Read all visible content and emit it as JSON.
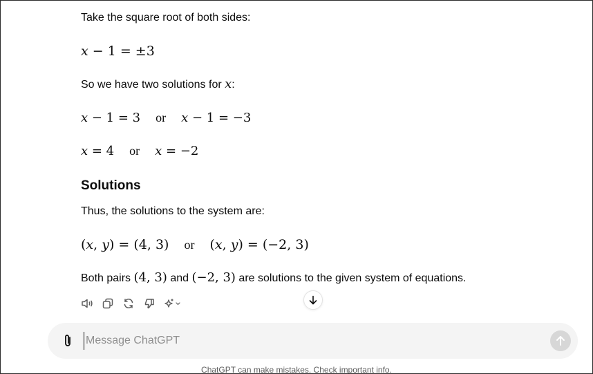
{
  "message": {
    "step_text": "Take the square root of both sides:",
    "eq1": {
      "var": "x",
      "rest": " − 1 = ±3"
    },
    "two_solutions": {
      "before": "So we have two solutions for ",
      "var": "x",
      "after": ":"
    },
    "eq2": {
      "left_var": "x",
      "left_rest": " − 1 = 3",
      "or": "or",
      "right_var": "x",
      "right_rest": " − 1 = −3"
    },
    "eq3": {
      "left_var": "x",
      "left_rest": " = 4",
      "or": "or",
      "right_var": "x",
      "right_rest": " = −2"
    },
    "solutions_heading": "Solutions",
    "thus_text": "Thus, the solutions to the system are:",
    "eq4": {
      "left_open": "(",
      "left_x": "x",
      "left_comma": ", ",
      "left_y": "y",
      "left_close": ") = (4, 3)",
      "or": "or",
      "right_open": "(",
      "right_x": "x",
      "right_comma": ", ",
      "right_y": "y",
      "right_close": ") = (−2, 3)"
    },
    "both_pairs": {
      "before": "Both pairs ",
      "pair1": "(4, 3)",
      "middle": " and ",
      "pair2": "(−2, 3)",
      "after": " are solutions to the given system of equations."
    }
  },
  "actions": {
    "icons": [
      "read-aloud-icon",
      "copy-icon",
      "regenerate-icon",
      "thumbs-down-icon",
      "model-switch-icon"
    ]
  },
  "composer": {
    "placeholder": "Message ChatGPT",
    "value": ""
  },
  "disclaimer": "ChatGPT can make mistakes. Check important info."
}
